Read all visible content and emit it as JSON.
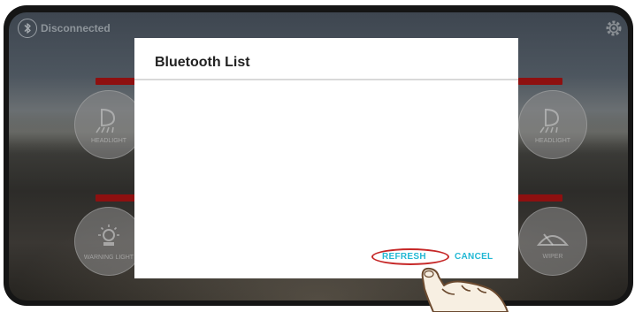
{
  "status": {
    "icon": "bluetooth-icon",
    "text": "Disconnected"
  },
  "settings_icon": "gear-icon",
  "controls": [
    {
      "icon": "headlight-icon",
      "label": "HEADLIGHT"
    },
    {
      "icon": "headlight-icon",
      "label": "HEADLIGHT"
    },
    {
      "icon": "warning-light-icon",
      "label": "WARNING LIGHT"
    },
    {
      "icon": "wiper-icon",
      "label": "WIPER"
    }
  ],
  "dialog": {
    "title": "Bluetooth List",
    "refresh_label": "REFRESH",
    "cancel_label": "CANCEL"
  },
  "colors": {
    "accent": "#22b8d4",
    "indicator": "#8e1010",
    "highlight": "#c62828"
  }
}
